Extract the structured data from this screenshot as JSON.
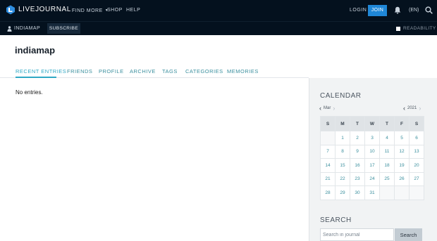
{
  "topnav": {
    "logo_text": "LIVEJOURNAL",
    "find_more": "FIND MORE",
    "shop": "SHOP",
    "help": "HELP",
    "login": "LOGIN",
    "join": "JOIN",
    "language": "(EN)",
    "icons": [
      "livejournal-logo-icon",
      "chevron-down-icon",
      "bell-icon",
      "search-icon"
    ]
  },
  "subnav": {
    "username": "INDIAMAP",
    "subscribe": "SUBSCRIBE",
    "readability": "READABILITY"
  },
  "journal": {
    "title": "indiamap",
    "tabs": [
      {
        "label": "RECENT ENTRIES",
        "active": true
      },
      {
        "label": "FRIENDS",
        "active": false
      },
      {
        "label": "PROFILE",
        "active": false
      },
      {
        "label": "ARCHIVE",
        "active": false
      },
      {
        "label": "TAGS",
        "active": false
      },
      {
        "label": "CATEGORIES",
        "active": false
      },
      {
        "label": "MEMORIES",
        "active": false
      }
    ],
    "empty_message": "No entries."
  },
  "calendar": {
    "heading": "CALENDAR",
    "month": "Mar",
    "year": "2021",
    "weekdays": [
      "S",
      "M",
      "T",
      "W",
      "T",
      "F",
      "S"
    ],
    "weeks": [
      [
        "",
        "1",
        "2",
        "3",
        "4",
        "5",
        "6"
      ],
      [
        "7",
        "8",
        "9",
        "10",
        "11",
        "12",
        "13"
      ],
      [
        "14",
        "15",
        "16",
        "17",
        "18",
        "19",
        "20"
      ],
      [
        "21",
        "22",
        "23",
        "24",
        "25",
        "26",
        "27"
      ],
      [
        "28",
        "29",
        "30",
        "31",
        "",
        "",
        ""
      ]
    ]
  },
  "search": {
    "heading": "SEARCH",
    "placeholder": "Search in journal",
    "button": "Search"
  },
  "colors": {
    "topbar": "#04111e",
    "join_button": "#1f87d7",
    "active_tab": "#2fa8c4",
    "link": "#3a8f9e",
    "sidebar": "#f1f3f4"
  }
}
